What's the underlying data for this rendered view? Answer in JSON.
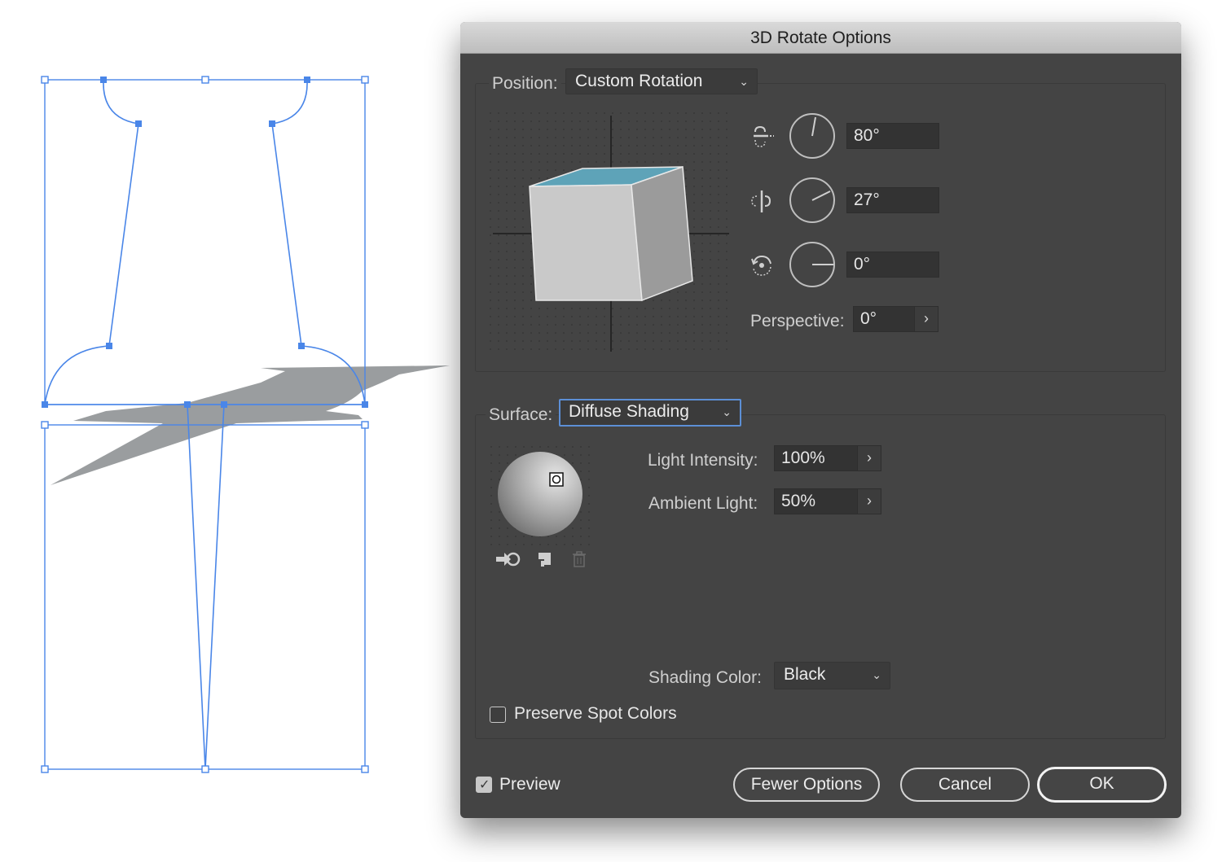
{
  "dialog": {
    "title": "3D Rotate Options",
    "position": {
      "label": "Position:",
      "value": "Custom Rotation",
      "rotation_x": "80°",
      "rotation_y": "27°",
      "rotation_z": "0°",
      "perspective_label": "Perspective:",
      "perspective_value": "0°"
    },
    "surface": {
      "label": "Surface:",
      "value": "Diffuse Shading",
      "light_intensity_label": "Light Intensity:",
      "light_intensity_value": "100%",
      "ambient_light_label": "Ambient Light:",
      "ambient_light_value": "50%",
      "shading_color_label": "Shading Color:",
      "shading_color_value": "Black",
      "preserve_spot_colors_label": "Preserve Spot Colors",
      "preserve_spot_colors_checked": false
    },
    "footer": {
      "preview_label": "Preview",
      "preview_checked": true,
      "fewer_options_label": "Fewer Options",
      "cancel_label": "Cancel",
      "ok_label": "OK"
    }
  },
  "colors": {
    "dialog_bg": "#444444",
    "selection_blue": "#4a86e8",
    "cube_top": "#5ea3b8",
    "shadow_gray": "#9a9d9f"
  }
}
